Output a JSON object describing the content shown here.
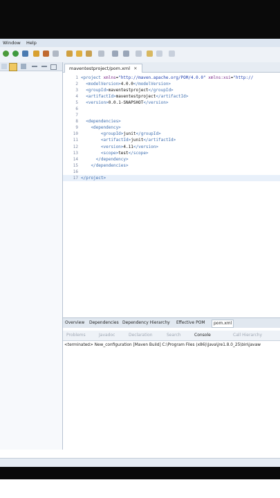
{
  "menu": {
    "window_label": "Window",
    "help_label": "Help"
  },
  "editor": {
    "tab_label": "maventestproject/pom.xml",
    "lines": [
      {
        "n": "1",
        "parts": [
          [
            "tag",
            "<project "
          ],
          [
            "attr",
            "xmlns"
          ],
          [
            "plain",
            "="
          ],
          [
            "val",
            "\"http://maven.apache.org/POM/4.0.0\""
          ],
          [
            "plain",
            " "
          ],
          [
            "attr",
            "xmlns:xsi"
          ],
          [
            "plain",
            "="
          ],
          [
            "val",
            "\"http://"
          ]
        ]
      },
      {
        "n": "2",
        "parts": [
          [
            "tag",
            "  <modelVersion>"
          ],
          [
            "plain",
            "4.0.0"
          ],
          [
            "tag",
            "</modelVersion>"
          ]
        ]
      },
      {
        "n": "3",
        "parts": [
          [
            "tag",
            "  <groupId>"
          ],
          [
            "plain",
            "maventestproject"
          ],
          [
            "tag",
            "</groupId>"
          ]
        ]
      },
      {
        "n": "4",
        "parts": [
          [
            "tag",
            "  <artifactId>"
          ],
          [
            "plain",
            "maventestproject"
          ],
          [
            "tag",
            "</artifactId>"
          ]
        ]
      },
      {
        "n": "5",
        "parts": [
          [
            "tag",
            "  <version>"
          ],
          [
            "plain",
            "0.0.1-SNAPSHOT"
          ],
          [
            "tag",
            "</version>"
          ]
        ]
      },
      {
        "n": "6",
        "parts": []
      },
      {
        "n": "7",
        "parts": []
      },
      {
        "n": "8",
        "parts": [
          [
            "tag",
            "  <dependencies>"
          ]
        ]
      },
      {
        "n": "9",
        "parts": [
          [
            "tag",
            "    <dependency>"
          ]
        ]
      },
      {
        "n": "10",
        "parts": [
          [
            "tag",
            "        <groupId>"
          ],
          [
            "plain",
            "junit"
          ],
          [
            "tag",
            "</groupId>"
          ]
        ]
      },
      {
        "n": "11",
        "parts": [
          [
            "tag",
            "        <artifactId>"
          ],
          [
            "plain",
            "junit"
          ],
          [
            "tag",
            "</artifactId>"
          ]
        ]
      },
      {
        "n": "12",
        "parts": [
          [
            "tag",
            "        <version>"
          ],
          [
            "plain",
            "4.11"
          ],
          [
            "tag",
            "</version>"
          ]
        ]
      },
      {
        "n": "13",
        "parts": [
          [
            "tag",
            "        <scope>"
          ],
          [
            "plain",
            "test"
          ],
          [
            "tag",
            "</scope>"
          ]
        ]
      },
      {
        "n": "14",
        "parts": [
          [
            "tag",
            "      </dependency>"
          ]
        ]
      },
      {
        "n": "15",
        "parts": [
          [
            "tag",
            "    </dependencies>"
          ]
        ]
      },
      {
        "n": "16",
        "parts": []
      },
      {
        "n": "17",
        "parts": [
          [
            "tag",
            "</project>"
          ]
        ]
      }
    ]
  },
  "pom_tabs": [
    "Overview",
    "Dependencies",
    "Dependency Hierarchy",
    "Effective POM",
    "pom.xml"
  ],
  "console": {
    "tabs": [
      "Problems",
      "Javadoc",
      "Declaration",
      "Search",
      "Console",
      "Call Hierarchy"
    ],
    "active_tab": "Console",
    "output": "<terminated> New_configuration [Maven Build] C:\\Program Files (x86)\\Java\\jre1.8.0_25\\bin\\javaw"
  }
}
